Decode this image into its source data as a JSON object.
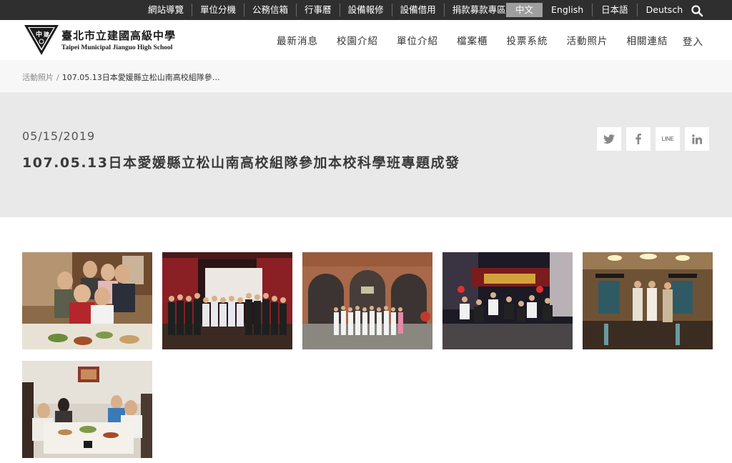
{
  "topbar": {
    "links": [
      "網站導覽",
      "單位分機",
      "公務信箱",
      "行事曆",
      "設備報修",
      "設備借用",
      "捐款募款專區"
    ],
    "languages": [
      "中文",
      "English",
      "日本語",
      "Deutsch"
    ],
    "active_language": "中文",
    "search_icon": "search-icon"
  },
  "header": {
    "logo_name": "臺北市立建國高級中學",
    "logo_name_en": "Taipei Municipal Jianguo High School",
    "logo_glyph_top": "中",
    "logo_glyph_right": "建",
    "nav": [
      "最新消息",
      "校園介紹",
      "單位介紹",
      "檔案櫃",
      "投票系統",
      "活動照片",
      "相關連結"
    ],
    "login": "登入"
  },
  "breadcrumb": {
    "parent": "活動照片",
    "separator": "/",
    "current": "107.05.13日本愛媛縣立松山南高校組隊參…"
  },
  "article": {
    "date": "05/15/2019",
    "title": "107.05.13日本愛媛縣立松山南高校組隊參加本校科學班專題成發",
    "share": {
      "twitter": "twitter-icon",
      "facebook": "facebook-icon",
      "line_label": "LINE",
      "linkedin": "linkedin-icon"
    }
  },
  "gallery": {
    "photos": [
      "photo-dinner-group",
      "photo-stage-group",
      "photo-station-building",
      "photo-night-street-jump",
      "photo-cafe-lobby",
      "photo-dinner-table"
    ]
  },
  "colors": {
    "topbar": "#2f2f2f",
    "active_lang": "#9e9e9e",
    "breadcrumb_bg": "#f7f7f7",
    "titleband_bg": "#e9e9ea",
    "text": "#333333"
  }
}
